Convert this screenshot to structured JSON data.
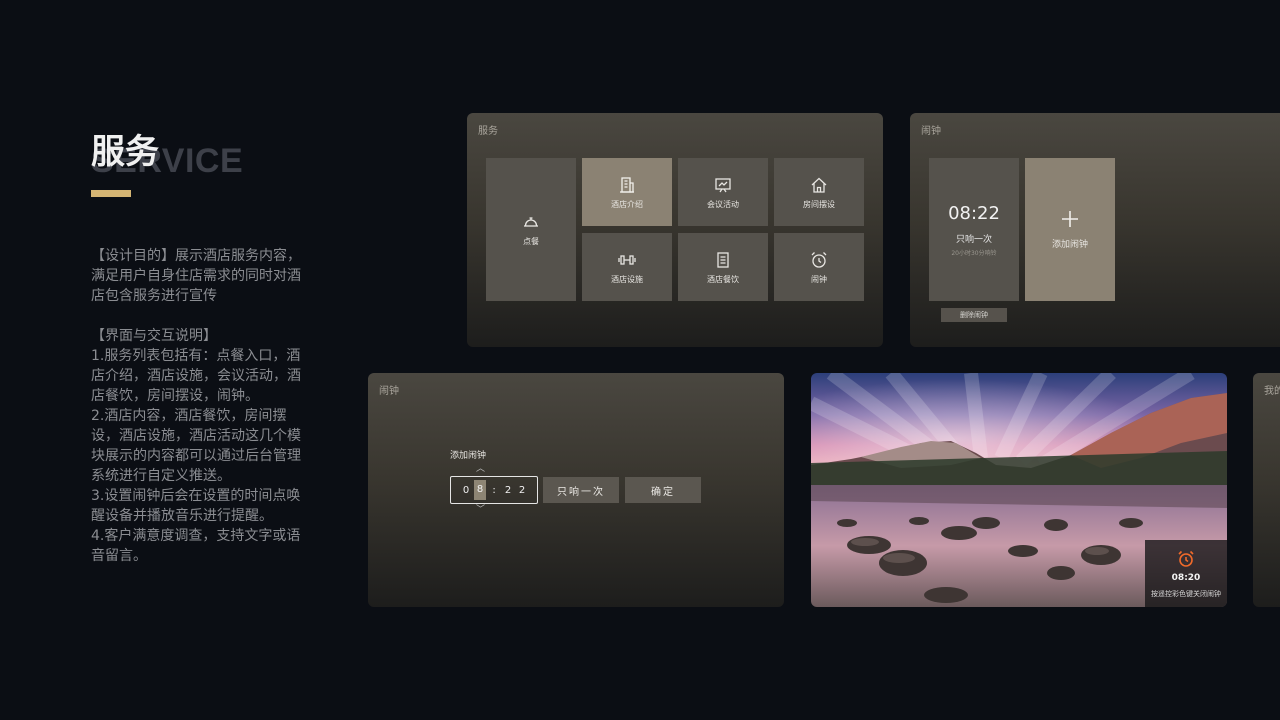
{
  "header": {
    "title_cn": "服务",
    "title_en": "SERVICE"
  },
  "description": {
    "purpose_lines": [
      "【设计目的】展示酒店服务内容，满足用户自身住店需求的同时对酒店包含服务进行宣传"
    ],
    "interaction_title": "【界面与交互说明】",
    "items": [
      "1.服务列表包括有：点餐入口，酒店介绍，酒店设施，会议活动，酒店餐饮，房间摆设，闹钟。",
      "2.酒店内容，酒店餐饮，房间摆设，酒店设施，酒店活动这几个模块展示的内容都可以通过后台管理系统进行自定义推送。",
      "3.设置闹钟后会在设置的时间点唤醒设备并播放音乐进行提醒。",
      "4.客户满意度调查，支持文字或语音留言。"
    ]
  },
  "service_panel": {
    "title": "服务",
    "tiles": [
      {
        "label": "点餐",
        "icon": "cloche-icon"
      },
      {
        "label": "酒店介绍",
        "icon": "building-icon",
        "active": true
      },
      {
        "label": "会议活动",
        "icon": "presentation-board-icon"
      },
      {
        "label": "房间摆设",
        "icon": "home-icon"
      },
      {
        "label": "酒店设施",
        "icon": "dumbbell-icon"
      },
      {
        "label": "酒店餐饮",
        "icon": "menu-list-icon"
      },
      {
        "label": "闹钟",
        "icon": "alarm-clock-icon"
      }
    ]
  },
  "alarm_panel": {
    "title": "闹钟",
    "alarm_time": "08:22",
    "repeat": "只响一次",
    "countdown": "20小时30分响铃",
    "add_label": "添加闹钟",
    "delete_label": "删除闹钟"
  },
  "add_alarm_panel": {
    "title": "闹钟",
    "label": "添加闹钟",
    "digits": [
      "0",
      "8",
      "2",
      "2"
    ],
    "separator": ":",
    "repeat_button": "只响一次",
    "confirm_button": "确定"
  },
  "ring_screen": {
    "time": "08:20",
    "message": "按遥控彩色键关闭闹钟",
    "icon": "alarm-clock-icon",
    "accent": "#f06a2a"
  },
  "edge_panel": {
    "title": "我的"
  },
  "colors": {
    "background": "#0b0e14",
    "accent_bar": "#d5b574",
    "active_tile": "#8b8273"
  }
}
